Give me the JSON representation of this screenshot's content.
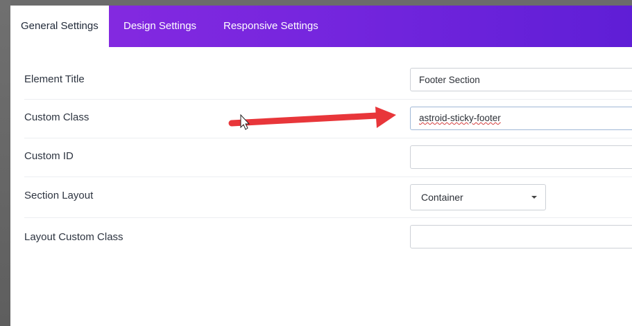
{
  "tabs": [
    {
      "label": "General Settings",
      "active": true
    },
    {
      "label": "Design Settings",
      "active": false
    },
    {
      "label": "Responsive Settings",
      "active": false
    }
  ],
  "form": {
    "element_title": {
      "label": "Element Title",
      "value": "Footer Section"
    },
    "custom_class": {
      "label": "Custom Class",
      "value": "astroid-sticky-footer"
    },
    "custom_id": {
      "label": "Custom ID",
      "value": ""
    },
    "section_layout": {
      "label": "Section Layout",
      "selected": "Container"
    },
    "layout_custom_class": {
      "label": "Layout Custom Class",
      "value": ""
    }
  },
  "colors": {
    "tab_gradient_start": "#8a2be2",
    "tab_gradient_end": "#5f1ed6",
    "annotation_arrow": "#e8363a"
  },
  "icons": [
    "chevron-down-icon",
    "mouse-cursor-icon",
    "annotation-arrow-icon"
  ]
}
